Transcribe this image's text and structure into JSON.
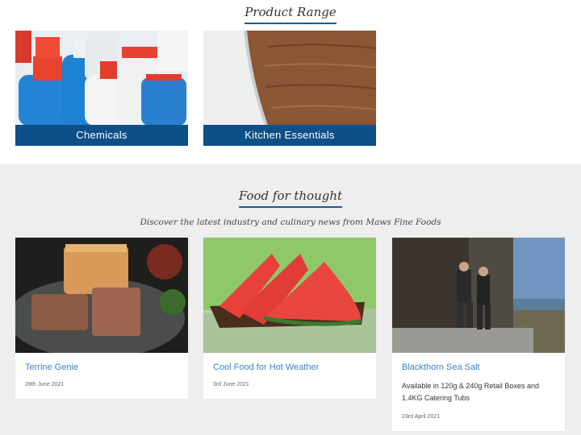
{
  "product_range": {
    "title": "Product Range",
    "categories": [
      {
        "label": "Chemicals"
      },
      {
        "label": "Kitchen Essentials"
      }
    ]
  },
  "news": {
    "title": "Food for thought",
    "subtitle": "Discover the latest industry and culinary news from Maws Fine Foods",
    "articles": [
      {
        "title": "Terrine Genie",
        "date": "28th June 2021"
      },
      {
        "title": "Cool Food for Hot Weather",
        "date": "3rd June 2021"
      },
      {
        "title": "Blackthorn Sea Salt",
        "description": "Available in 120g & 240g Retail Boxes and 1.4KG Catering Tubs",
        "date": "23rd April 2021"
      }
    ]
  },
  "colors": {
    "accent": "#0e4f87",
    "link": "#3b82c4",
    "section_bg": "#eeeeee"
  }
}
